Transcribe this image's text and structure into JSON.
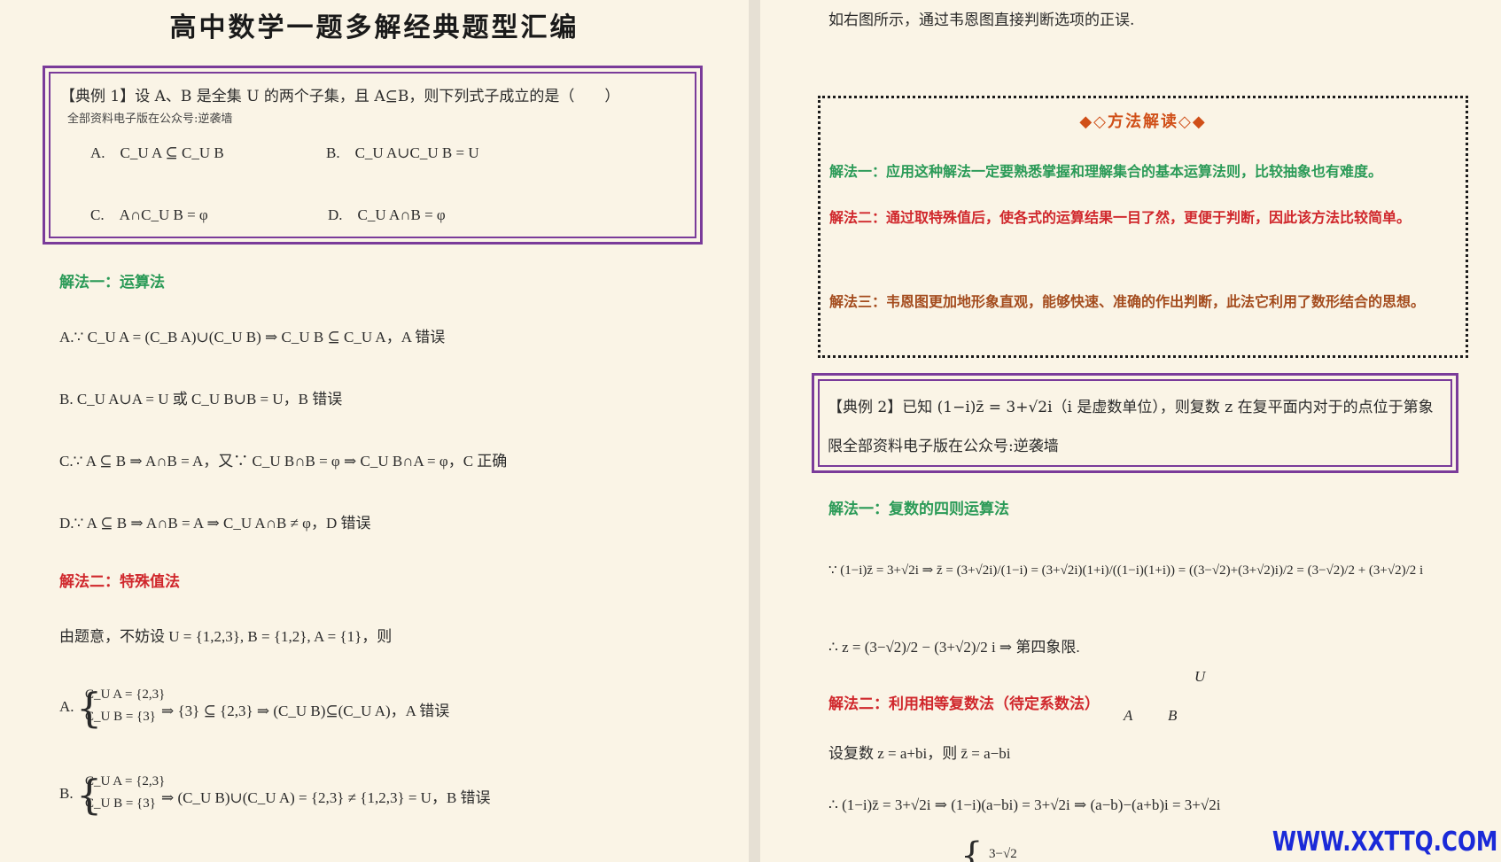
{
  "left": {
    "title": "高中数学一题多解经典题型汇编",
    "example1": {
      "question": "【典例 1】设 A、B 是全集 U 的两个子集，且 A⊆B，则下列式子成立的是（　　）",
      "note": "全部资料电子版在公众号:逆袭墙",
      "options": [
        "A.　C_U A ⊆ C_U B",
        "B.　C_U A∪C_U B = U",
        "C.　A∩C_U B = φ",
        "D.　C_U A∩B = φ"
      ]
    },
    "method1_title": "解法一：运算法",
    "method1_lines": [
      "A.∵ C_U A = (C_B A)∪(C_U B) ⇒ C_U B ⊆ C_U A，A 错误",
      "B. C_U A∪A = U 或 C_U B∪B = U，B 错误",
      "C.∵ A ⊆ B ⇒ A∩B = A，又∵ C_U B∩B = φ ⇒ C_U B∩A = φ，C 正确",
      "D.∵ A ⊆ B ⇒ A∩B = A ⇒ C_U A∩B ≠ φ，D 错误"
    ],
    "method2_title": "解法二：特殊值法",
    "method2_intro": "由题意，不妨设 U = {1,2,3}, B = {1,2}, A = {1}，则",
    "caseA": {
      "label": "A.",
      "brace": [
        "C_U A = {2,3}",
        "C_U B = {3}"
      ],
      "rest": "⇒ {3} ⊆ {2,3} ⇒ (C_U B)⊆(C_U A)，A 错误"
    },
    "caseB": {
      "label": "B.",
      "brace": [
        "C_U A = {2,3}",
        "C_U B = {3}"
      ],
      "rest": "⇒ (C_U B)∪(C_U A) = {2,3} ≠ {1,2,3} = U，B 错误"
    }
  },
  "right": {
    "top_line": "如右图所示，通过韦恩图直接判断选项的正误.",
    "method_box": {
      "heading": "◆◇方法解读◇◆",
      "s1": "解法一：应用这种解法一定要熟悉掌握和理解集合的基本运算法则，比较抽象也有难度。",
      "s2": "解法二：通过取特殊值后，使各式的运算结果一目了然，更便于判断，因此该方法比较简单。",
      "s3": "解法三：韦恩图更加地形象直观，能够快速、准确的作出判断，此法它利用了数形结合的思想。"
    },
    "example2": {
      "text": "【典例 2】已知 (1−i)z̄ = 3+√2i（i 是虚数单位），则复数 z 在复平面内对于的点位于第象限全部资料电子版在公众号:逆袭墙"
    },
    "sol1_title": "解法一：复数的四则运算法",
    "eq1": "∵ (1−i)z̄ = 3+√2i ⇒ z̄ = (3+√2i)/(1−i) = (3+√2i)(1+i)/((1−i)(1+i)) = ((3−√2)+(3+√2)i)/2 = (3−√2)/2 + (3+√2)/2 i",
    "eq2": "∴ z = (3−√2)/2 − (3+√2)/2 i  ⇒ 第四象限.",
    "venn": {
      "U": "U",
      "A": "A",
      "B": "B"
    },
    "sol2_title": "解法二：利用相等复数法（待定系数法）",
    "eq3": "设复数 z = a+bi，则 z̄ = a−bi",
    "eq4": "∴ (1−i)z̄ = 3+√2i ⇒ (1−i)(a−bi) = 3+√2i ⇒ (a−b)−(a+b)i = 3+√2i",
    "eq5_partial": "3−√2"
  },
  "watermark": "WWW.XXTTQ.COM",
  "colors": {
    "purple_border": "#7a3b9a",
    "green": "#2a9a57",
    "red": "#d0272c",
    "orange": "#a44c1e",
    "watermark": "#1a2ad8"
  }
}
